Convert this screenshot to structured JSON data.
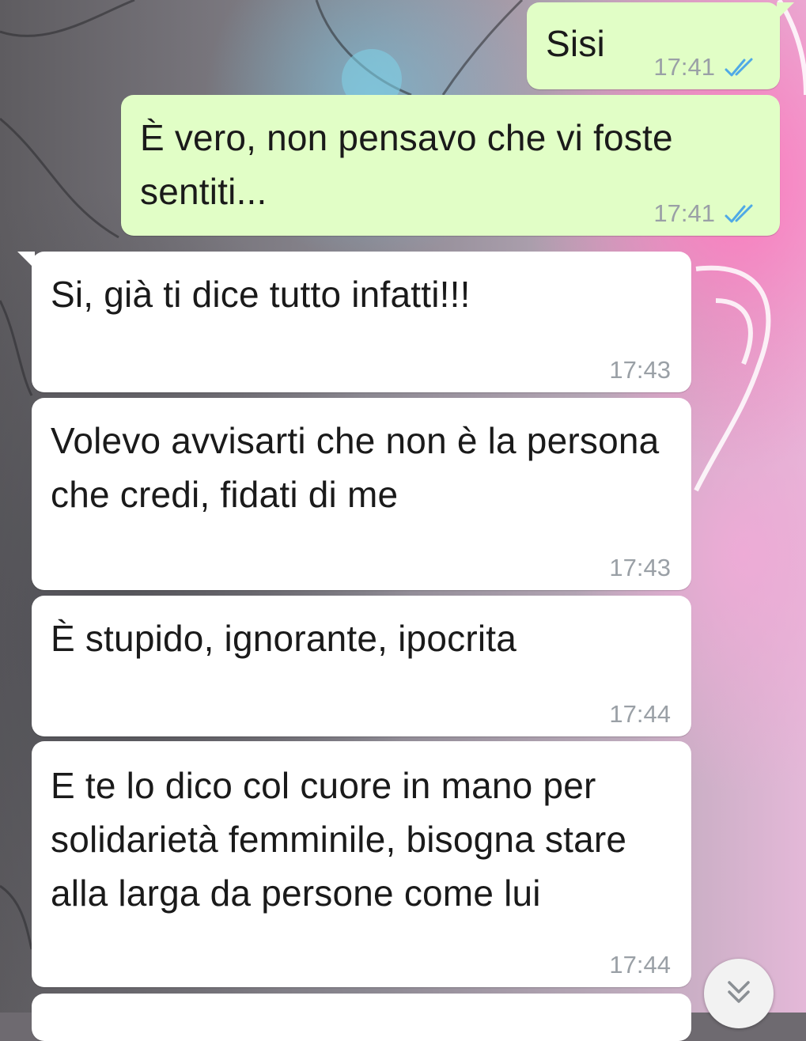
{
  "messages": [
    {
      "text": "Sisi",
      "time": "17:41",
      "direction": "outgoing",
      "status": "read-double-check"
    },
    {
      "text": "È vero, non pensavo che vi foste sentiti...",
      "time": "17:41",
      "direction": "outgoing",
      "status": "read-double-check"
    },
    {
      "text": "Si, già ti dice tutto infatti!!!",
      "time": "17:43",
      "direction": "incoming"
    },
    {
      "text": "Volevo avvisarti che non è la persona che credi, fidati di me",
      "time": "17:43",
      "direction": "incoming"
    },
    {
      "text": "È stupido, ignorante, ipocrita",
      "time": "17:44",
      "direction": "incoming"
    },
    {
      "text": "E te lo dico col cuore in mano per solidarietà femminile, bisogna stare alla larga da persone come lui",
      "time": "17:44",
      "direction": "incoming"
    }
  ],
  "icons": {
    "read_receipt": "double-check-icon",
    "scroll_down": "chevron-double-down-icon"
  },
  "colors": {
    "outgoing_bubble": "#e1fec6",
    "incoming_bubble": "#ffffff",
    "read_tick": "#4fa9e6",
    "timestamp": "#9aa0a6"
  }
}
